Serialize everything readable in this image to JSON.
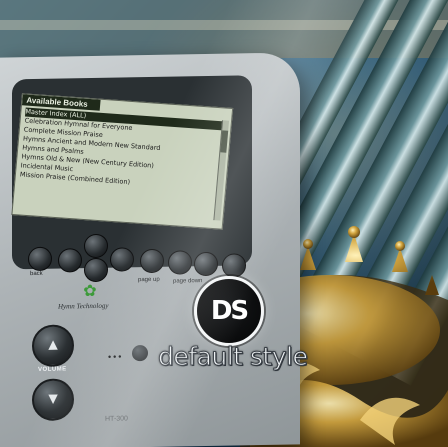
{
  "screen": {
    "title": "Available Books",
    "items": [
      "Master Index (ALL)",
      "Celebration Hymnal for Everyone",
      "Complete Mission Praise",
      "Hymns Ancient and Modern New Standard",
      "Hymns and Psalms",
      "Hymns Old & New (New Century Edition)",
      "Incidental Music",
      "Mission Praise (Combined Edition)"
    ],
    "selected_index": 0
  },
  "keys": {
    "back_label": "back",
    "page_up_label": "page up",
    "page_down_label": "page down"
  },
  "device": {
    "brand": "Hymn Technology",
    "volume_label": "VOLUME",
    "model": "HT-300"
  },
  "logo": {
    "monogram": "DS",
    "wordmark": "default style"
  },
  "colors": {
    "background": "#0e4f83",
    "device_body": "#b8bec1",
    "screen_lcd": "#c9d2bd",
    "gold": "#c9a24a"
  }
}
